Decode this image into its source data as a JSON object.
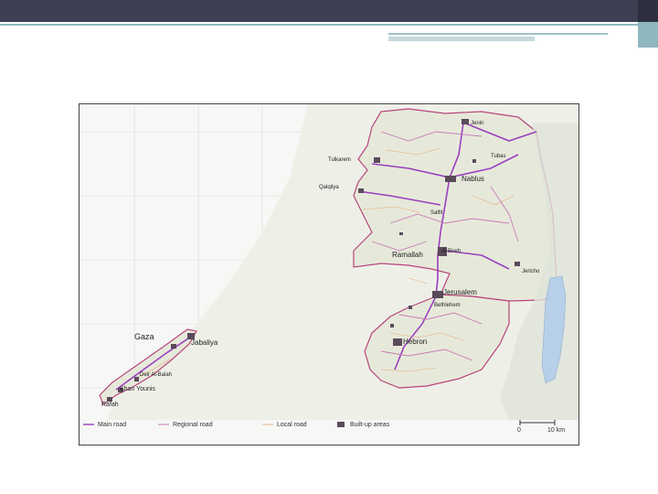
{
  "map": {
    "places": {
      "tulkarem": "Tulkarem",
      "qalqilya": "Qalqilya",
      "jenin": "Jenin",
      "tubas": "Tubas",
      "nablus": "Nablus",
      "salfit": "Salfit",
      "ramallah": "Ramallah",
      "albireh": "Al Bireh",
      "jericho": "Jericho",
      "jerusalem": "Jerusalem",
      "bethlehem": "Bethlehem",
      "hebron": "Hebron",
      "gaza": "Gaza",
      "jabaliya": "Jabaliya",
      "deir_al_balah": "Deir Al-Balah",
      "khan_younis": "Khan Younis",
      "rafah": "Rafah"
    },
    "legend": {
      "main_road": "Main road",
      "regional_road": "Regional road",
      "local_road": "Local road",
      "built_up": "Built-up areas",
      "scale_zero": "0",
      "scale_end": "10 km"
    },
    "colors": {
      "main_road": "#9b3fbf",
      "regional_road": "#c77ab5",
      "local_road": "#e8a070",
      "built_up": "#5a4a5a",
      "land": "#e9ecdf",
      "sea": "#f7f7f5",
      "dead_sea": "#b7cfe8"
    }
  }
}
